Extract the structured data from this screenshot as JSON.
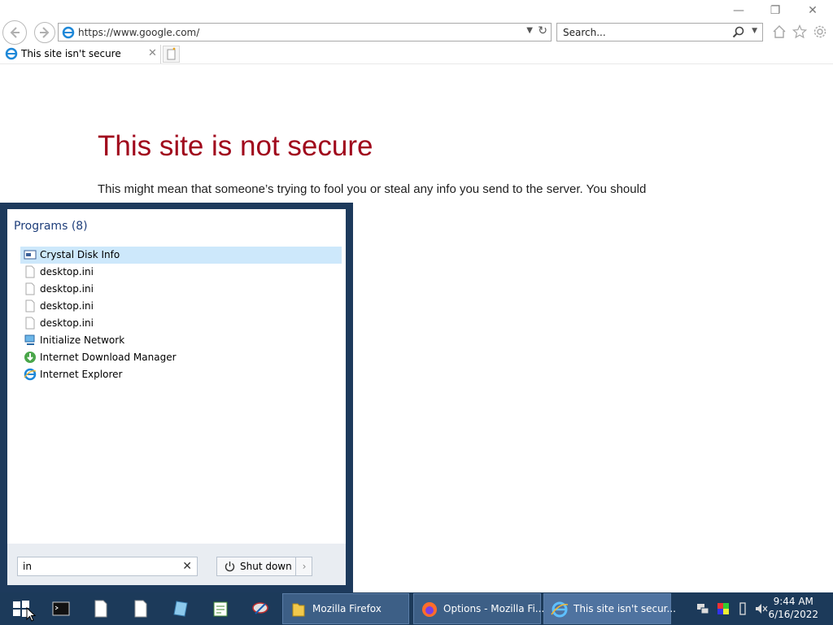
{
  "browser": {
    "address": "https://www.google.com/",
    "search_placeholder": "Search...",
    "tab_title": "This site isn't secure"
  },
  "page": {
    "title": "This site is not secure",
    "body": "This might mean that someone’s trying to fool you or steal any info you send to the server. You should"
  },
  "start_menu": {
    "programs_header": "Programs (8)",
    "programs": [
      {
        "label": "Crystal Disk Info",
        "icon": "crystal-disk-info-icon",
        "selected": true
      },
      {
        "label": "desktop.ini",
        "icon": "file-icon"
      },
      {
        "label": "desktop.ini",
        "icon": "file-icon"
      },
      {
        "label": "desktop.ini",
        "icon": "file-icon"
      },
      {
        "label": "desktop.ini",
        "icon": "file-icon"
      },
      {
        "label": "Initialize Network",
        "icon": "network-icon"
      },
      {
        "label": "Internet Download Manager",
        "icon": "idm-icon"
      },
      {
        "label": "Internet Explorer",
        "icon": "ie-icon"
      }
    ],
    "search_value": "in",
    "shutdown_label": "Shut down"
  },
  "taskbar": {
    "windows": [
      {
        "label": "Mozilla Firefox",
        "icon": "folder-icon"
      },
      {
        "label": "Options - Mozilla Fi...",
        "icon": "firefox-icon"
      },
      {
        "label": "This site isn't secur...",
        "icon": "ie-icon",
        "active": true
      }
    ],
    "time": "9:44 AM",
    "date": "6/16/2022"
  },
  "colors": {
    "title_red": "#a0081c",
    "taskbar_bg": "#1c3a5a",
    "start_border": "#1d3a5c",
    "selection": "#cde8fb"
  }
}
